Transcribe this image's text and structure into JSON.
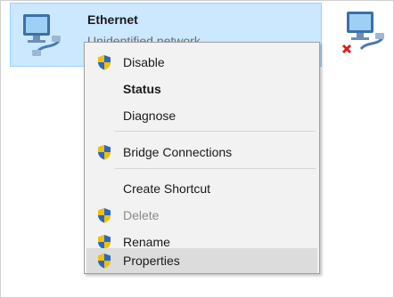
{
  "adapters": [
    {
      "name": "Ethernet",
      "status": "Unidentified network",
      "selected": true,
      "icon": "network-adapter-icon"
    },
    {
      "icon": "network-adapter-disconnected-icon"
    }
  ],
  "context_menu": {
    "items": [
      {
        "label": "Disable",
        "icon": "uac-shield-icon",
        "bold": false,
        "disabled": false
      },
      {
        "label": "Status",
        "bold": true,
        "disabled": false
      },
      {
        "label": "Diagnose",
        "bold": false,
        "disabled": false
      },
      {
        "label": "Bridge Connections",
        "icon": "uac-shield-icon",
        "bold": false,
        "disabled": false
      },
      {
        "label": "Create Shortcut",
        "bold": false,
        "disabled": false
      },
      {
        "label": "Delete",
        "icon": "uac-shield-icon",
        "bold": false,
        "disabled": true
      },
      {
        "label": "Rename",
        "icon": "uac-shield-icon",
        "bold": false,
        "disabled": false
      },
      {
        "label": "Properties",
        "icon": "uac-shield-icon",
        "bold": false,
        "disabled": false,
        "highlighted": true
      }
    ]
  },
  "colors": {
    "selection_bg": "#cce8ff",
    "menu_bg": "#f2f2f2",
    "highlight_bg": "#dcdcdc",
    "shield_blue": "#2a67c9",
    "shield_yellow": "#f5c000",
    "disconnected_red": "#d62020"
  }
}
